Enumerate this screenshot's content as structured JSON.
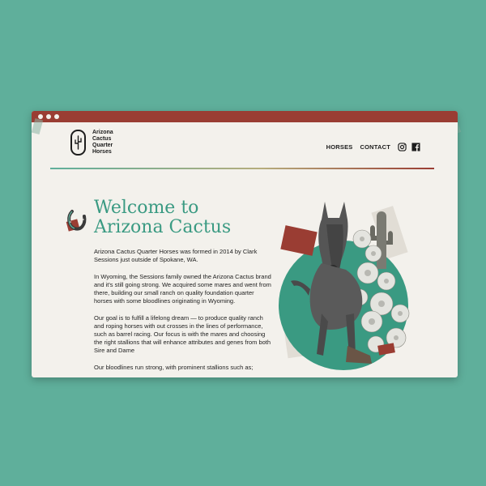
{
  "window": {
    "controls": [
      "close",
      "minimize",
      "maximize"
    ]
  },
  "site": {
    "logo_lines": [
      "Arizona",
      "Cactus",
      "Quarter",
      "Horses"
    ],
    "logo_icon": "cactus-icon"
  },
  "nav": {
    "horses": "HORSES",
    "contact": "CONTACT",
    "icons": [
      "instagram-icon",
      "facebook-icon"
    ]
  },
  "hero": {
    "heading_line1": "Welcome to",
    "heading_line2": "Arizona Cactus",
    "paragraphs": [
      "Arizona Cactus Quarter Horses was formed in 2014 by Clark Sessions just outside of Spokane, WA.",
      "In Wyoming, the Sessions family owned the Arizona Cactus brand and it's still going strong. We acquired some mares and went from there, building our small ranch on quality foundation quarter horses with some bloodlines originating in Wyoming.",
      "Our goal is to fulfill a lifelong dream — to produce quality ranch and roping horses with out crosses in the lines of performance, such as barrel racing. Our focus is with the mares and choosing the right stallions that will enhance attributes and genes from both Sire and Dame",
      "Our bloodlines run strong, with prominent stallions such as;"
    ]
  },
  "colors": {
    "background": "#5faf9b",
    "accent_red": "#9a3d33",
    "heading_green": "#3a9a82",
    "paper": "#f3f1ec"
  }
}
